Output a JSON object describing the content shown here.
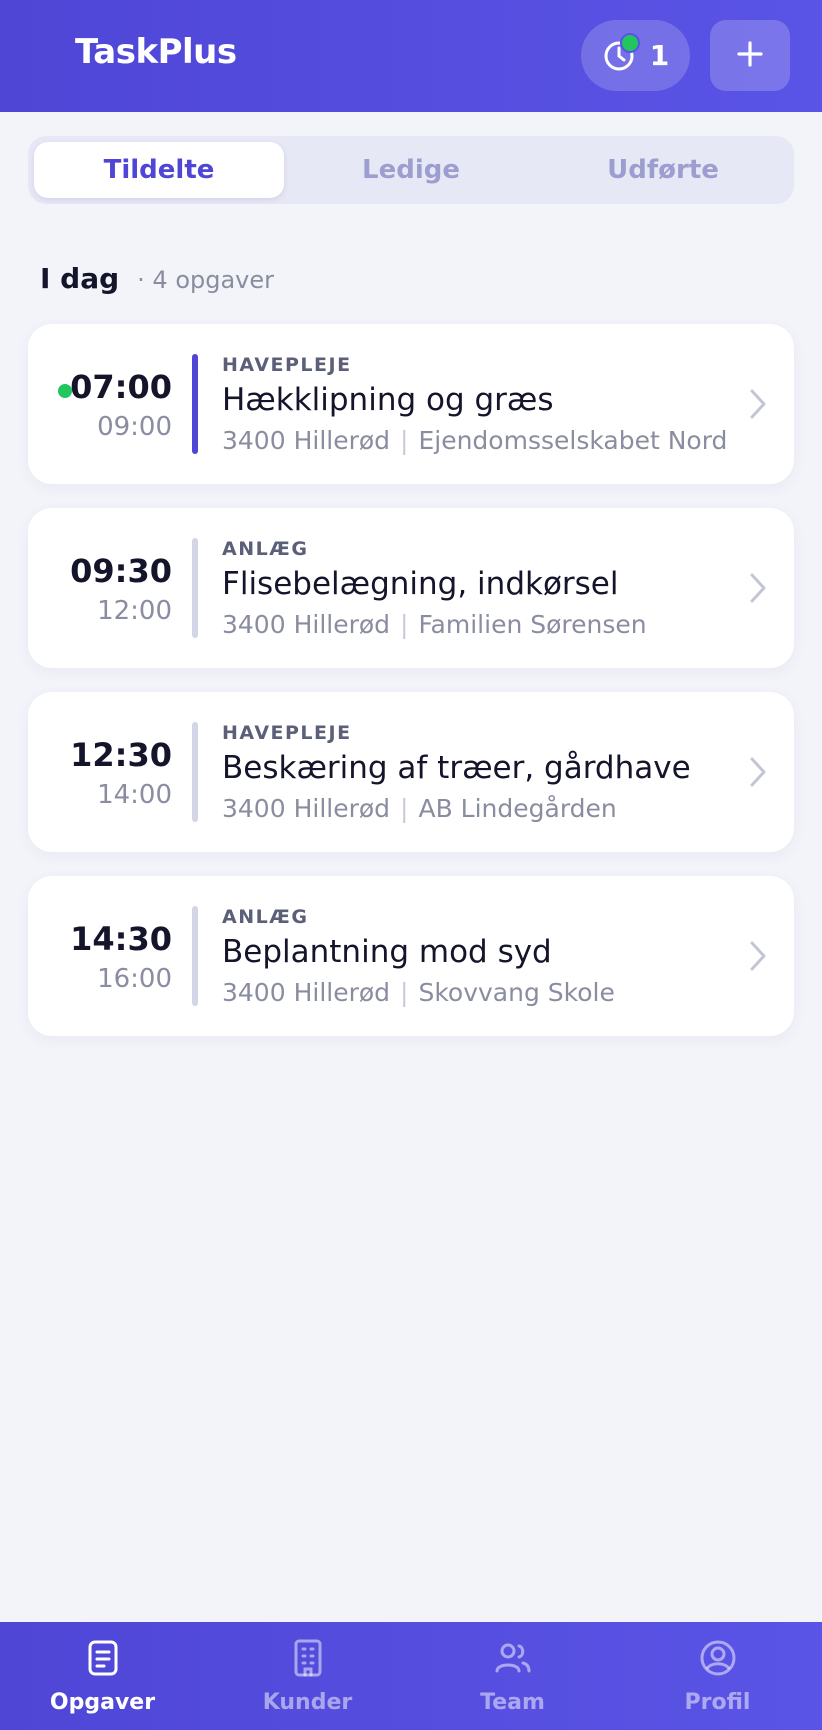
{
  "app": {
    "title": "TaskPlus"
  },
  "header": {
    "timer_count": "1",
    "add_icon": "plus-icon",
    "timer_icon": "clock-icon"
  },
  "tabs": [
    {
      "label": "Tildelte",
      "active": true
    },
    {
      "label": "Ledige",
      "active": false
    },
    {
      "label": "Udførte",
      "active": false
    }
  ],
  "section": {
    "title": "I dag",
    "count": "· 4 opgaver"
  },
  "tasks": [
    {
      "start": "07:00",
      "end": "09:00",
      "category": "HAVEPLEJE",
      "title": "Hækklipning og græs",
      "postal": "3400 Hillerød",
      "customer": "Ejendomsselskabet Nord",
      "in_progress": true
    },
    {
      "start": "09:30",
      "end": "12:00",
      "category": "ANLÆG",
      "title": "Flisebelægning, indkørsel",
      "postal": "3400 Hillerød",
      "customer": "Familien Sørensen",
      "in_progress": false
    },
    {
      "start": "12:30",
      "end": "14:00",
      "category": "HAVEPLEJE",
      "title": "Beskæring af træer, gårdhave",
      "postal": "3400 Hillerød",
      "customer": "AB Lindegården",
      "in_progress": false
    },
    {
      "start": "14:30",
      "end": "16:00",
      "category": "ANLÆG",
      "title": "Beplantning mod syd",
      "postal": "3400 Hillerød",
      "customer": "Skovvang Skole",
      "in_progress": false
    }
  ],
  "nav": [
    {
      "label": "Opgaver",
      "icon": "clipboard-icon",
      "active": true
    },
    {
      "label": "Kunder",
      "icon": "building-icon",
      "active": false
    },
    {
      "label": "Team",
      "icon": "users-icon",
      "active": false
    },
    {
      "label": "Profil",
      "icon": "user-circle-icon",
      "active": false
    }
  ],
  "colors": {
    "primary": "#4f46d6",
    "live": "#22c55e",
    "background": "#f3f4fa"
  }
}
